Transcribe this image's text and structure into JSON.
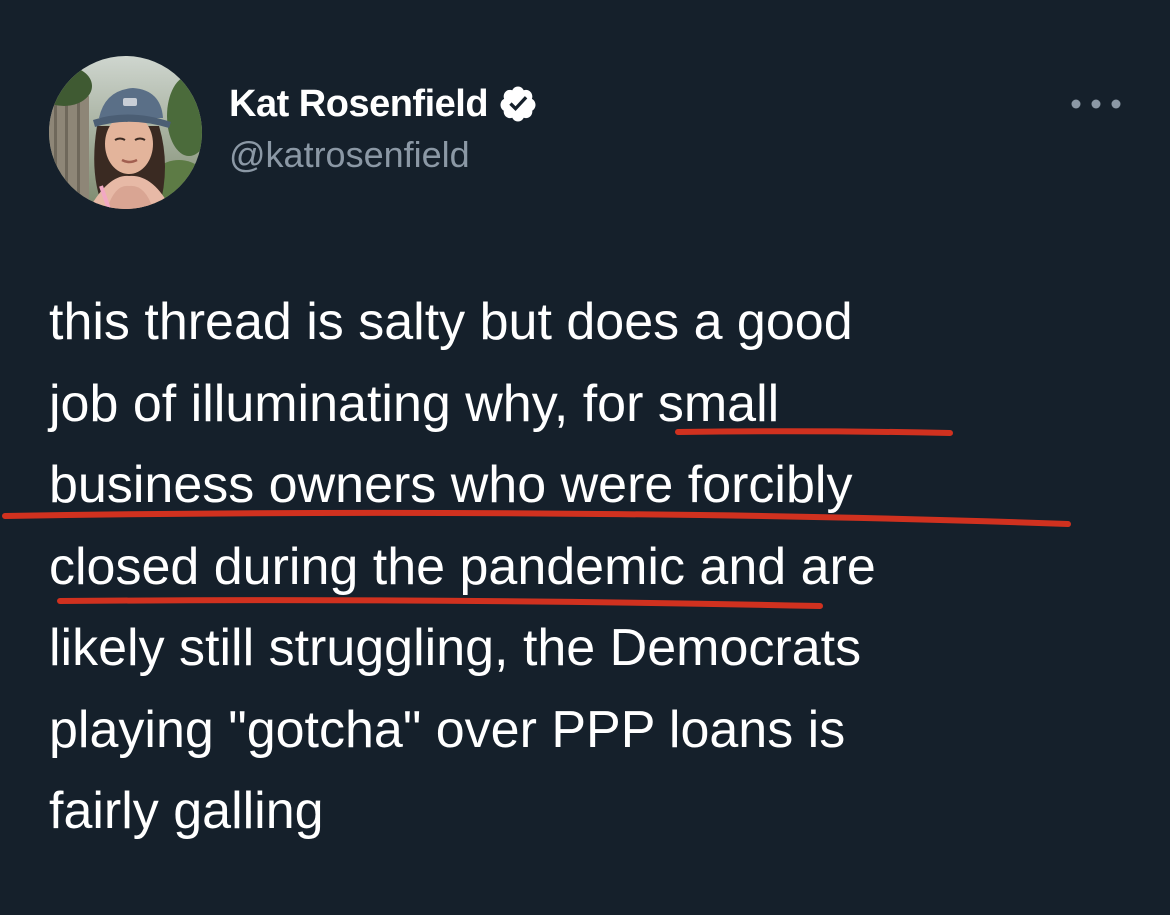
{
  "author": {
    "display_name": "Kat Rosenfield",
    "handle": "@katrosenfield",
    "verified": true
  },
  "icons": {
    "verified": "verified-badge-icon",
    "more": "more-options-icon"
  },
  "tweet": {
    "lines": [
      "this thread is salty but does a good",
      "job of illuminating why, for small",
      "business owners who were forcibly",
      "closed during the pandemic and are",
      "likely still struggling, the Democrats",
      "playing \"gotcha\" over PPP loans is",
      "fairly galling"
    ],
    "underlined_phrase": "for small business owners who were forcibly closed during the pandemic"
  },
  "colors": {
    "background": "#15202b",
    "text": "#ffffff",
    "secondary_text": "#8b98a5",
    "annotation": "#d0311f"
  }
}
